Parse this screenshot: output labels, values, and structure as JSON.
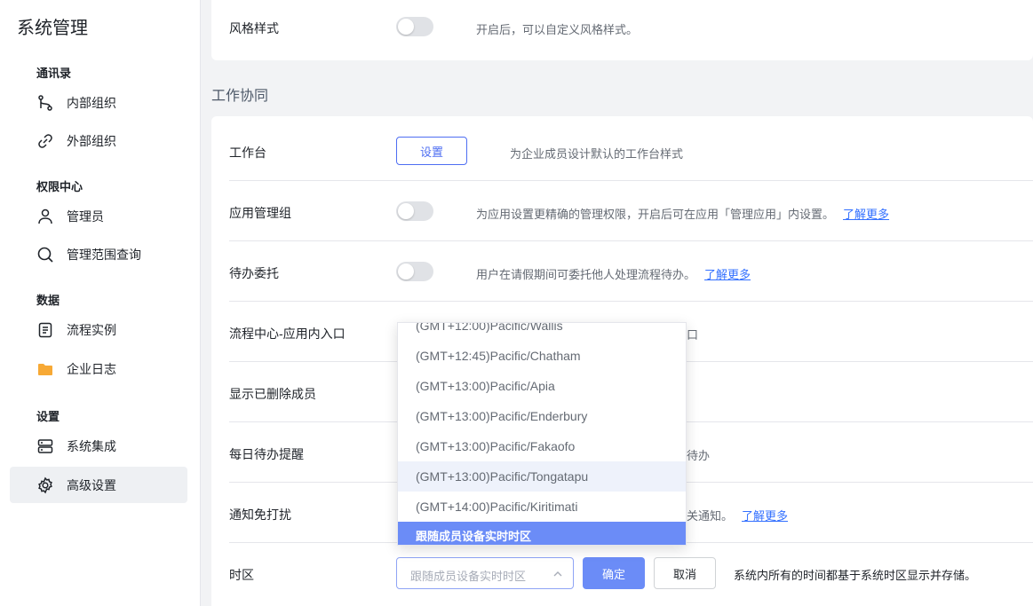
{
  "sidebar": {
    "title": "系统管理",
    "groups": {
      "contacts": "通讯录",
      "permissions": "权限中心",
      "data": "数据",
      "settings": "设置"
    },
    "items": [
      {
        "label": "内部组织",
        "icon": "org-branch-icon"
      },
      {
        "label": "外部组织",
        "icon": "link-icon"
      },
      {
        "label": "管理员",
        "icon": "user-icon"
      },
      {
        "label": "管理范围查询",
        "icon": "search-icon"
      },
      {
        "label": "流程实例",
        "icon": "document-icon"
      },
      {
        "label": "企业日志",
        "icon": "folder-icon"
      },
      {
        "label": "系统集成",
        "icon": "server-icon"
      },
      {
        "label": "高级设置",
        "icon": "gear-icon"
      }
    ],
    "active_item": "高级设置"
  },
  "style_row": {
    "label": "风格样式",
    "desc": "开启后，可以自定义风格样式。"
  },
  "section_title": "工作协同",
  "rows": {
    "workbench": {
      "label": "工作台",
      "button": "设置",
      "desc": "为企业成员设计默认的工作台样式"
    },
    "app_admin_group": {
      "label": "应用管理组",
      "desc": "为应用设置更精确的管理权限，开启后可在应用「管理应用」内设置。",
      "link": "了解更多"
    },
    "delegate": {
      "label": "待办委托",
      "desc": "用户在请假期间可委托他人处理流程待办。",
      "link": "了解更多"
    },
    "flow_entry": {
      "label": "流程中心-应用内入口",
      "desc_partial": "口"
    },
    "show_deleted": {
      "label": "显示已删除成员"
    },
    "daily_reminder": {
      "label": "每日待办提醒",
      "desc_partial": "待办"
    },
    "dnd": {
      "label": "通知免打扰",
      "desc_partial": "关通知。",
      "link": "了解更多"
    },
    "timezone": {
      "label": "时区",
      "placeholder": "跟随成员设备实时时区",
      "confirm": "确定",
      "cancel": "取消",
      "desc": "系统内所有的时间都基于系统时区显示并存储。"
    }
  },
  "timezone_dropdown": {
    "options": [
      "(GMT+12:00)Pacific/Wallis",
      "(GMT+12:45)Pacific/Chatham",
      "(GMT+13:00)Pacific/Apia",
      "(GMT+13:00)Pacific/Enderbury",
      "(GMT+13:00)Pacific/Fakaofo",
      "(GMT+13:00)Pacific/Tongatapu",
      "(GMT+14:00)Pacific/Kiritimati",
      "跟随成员设备实时时区"
    ],
    "hovered": "(GMT+13:00)Pacific/Tongatapu",
    "selected": "跟随成员设备实时时区"
  },
  "colors": {
    "primary": "#6b8cf7",
    "link": "#3370ff",
    "folder": "#f7a935"
  }
}
